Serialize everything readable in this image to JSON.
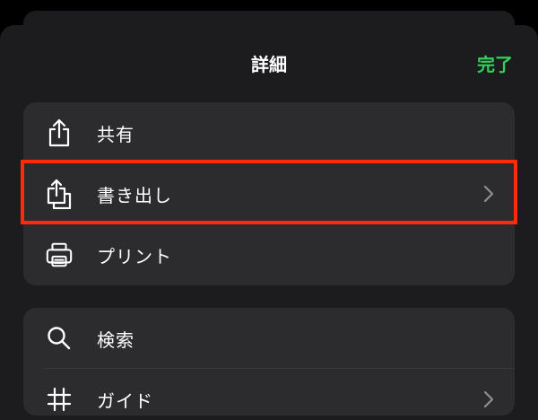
{
  "header": {
    "title": "詳細",
    "done_label": "完了"
  },
  "menu_group_1": {
    "items": [
      {
        "label": "共有",
        "icon": "share-icon"
      },
      {
        "label": "書き出し",
        "icon": "export-icon"
      },
      {
        "label": "プリント",
        "icon": "printer-icon"
      }
    ]
  },
  "menu_group_2": {
    "items": [
      {
        "label": "検索",
        "icon": "search-icon"
      },
      {
        "label": "ガイド",
        "icon": "grid-guide-icon"
      }
    ]
  },
  "colors": {
    "accent": "#30d158",
    "highlight": "#ff2a0a",
    "background": "#1c1c1e",
    "group": "#2c2c2e"
  }
}
